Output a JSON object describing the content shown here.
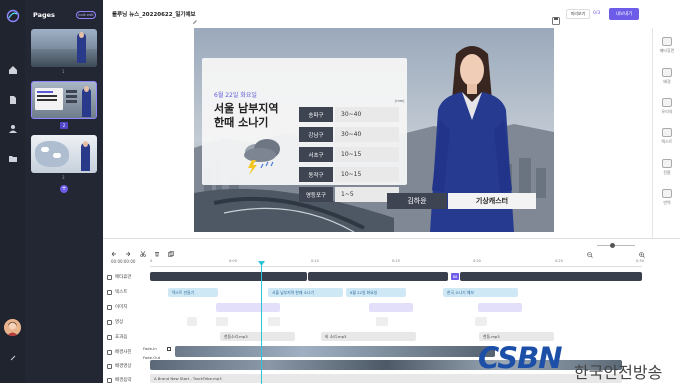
{
  "sidebar": {
    "pages_title": "Pages",
    "toggle_label": "bulk edit",
    "page_numbers": [
      "1",
      "2",
      "3"
    ],
    "add_page": "+",
    "footer_icon": "user-avatar"
  },
  "header": {
    "title": "롤루닝 뉴스_20220622_일기예보",
    "preview_label": "미리보기",
    "page_count": "0/3",
    "export_label": "내보내기"
  },
  "right_panel": {
    "items": [
      "메타휴먼",
      "배경",
      "유리의",
      "텍스트",
      "전환",
      "번역"
    ]
  },
  "slide": {
    "date": "6월 22일 화요일",
    "headline_line1": "서울 남부지역",
    "headline_line2": "한때 소나기",
    "unit": "(mm)",
    "rows": [
      {
        "district": "송파구",
        "value": "30~40"
      },
      {
        "district": "강남구",
        "value": "30~40"
      },
      {
        "district": "서초구",
        "value": "10~15"
      },
      {
        "district": "동작구",
        "value": "10~15"
      },
      {
        "district": "영등포구",
        "value": "1~5"
      }
    ],
    "anchor_name": "김하윤",
    "anchor_title": "기상캐스터"
  },
  "timeline": {
    "timecode": "00:00:00:00",
    "ticks": [
      "0",
      "0:05",
      "0:10",
      "0:15",
      "0:20",
      "0:25",
      "0:30"
    ],
    "tracks": [
      "메타휴먼",
      "텍스트",
      "이미지",
      "영상",
      "효과음",
      "배경사진",
      "배경영상",
      "배경음악"
    ],
    "text_clips": [
      "텍스트 만들기",
      "서울 남부지역 한때 소나기",
      "6월 22일 화요일",
      "한국 소나기 예보"
    ],
    "sfx_clips": [
      "천둥소리.mp3",
      "비 소리.mp3",
      "천둥.mp3"
    ],
    "fade_in": "Fade-In",
    "fade_out": "Fade-Out",
    "music_clip": "A Brand New Start - TrackTribe.mp3",
    "flag_label": "B8"
  },
  "watermark": {
    "logo_text": "CSBN",
    "caption": "한국안전방송"
  },
  "colors": {
    "accent": "#6c5ce7",
    "rail": "#20242f",
    "panel": "#232734",
    "playhead": "#2ec4d8",
    "table_label": "#3e4452"
  }
}
